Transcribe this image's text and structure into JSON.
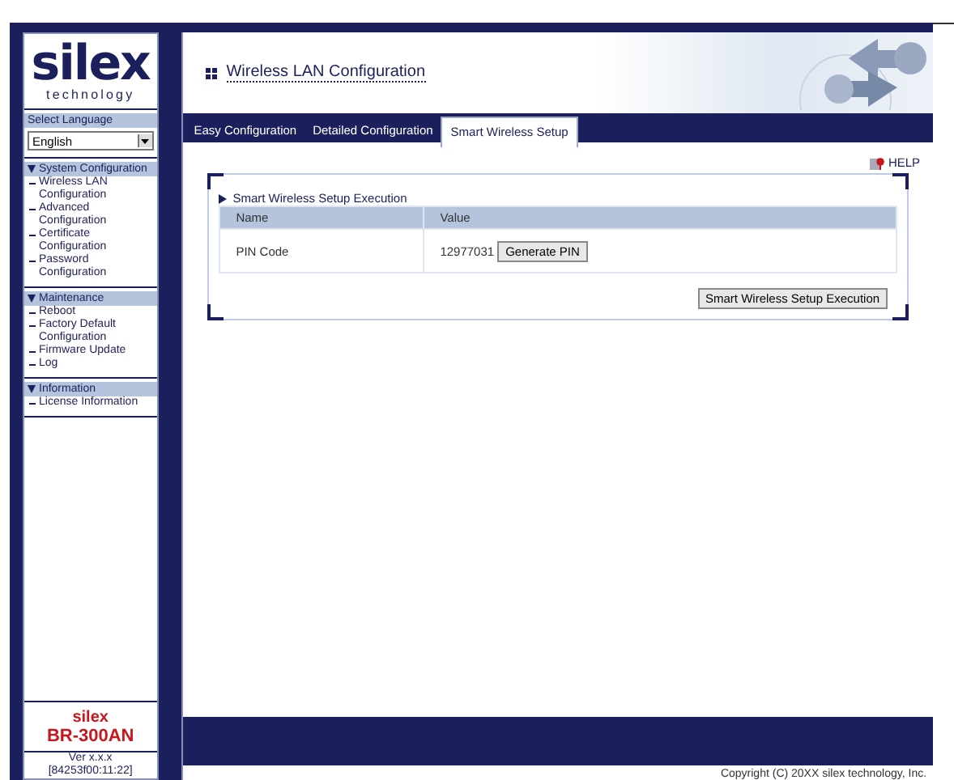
{
  "logo": {
    "name": "silex",
    "tagline": "technology"
  },
  "language": {
    "label": "Select Language",
    "value": "English"
  },
  "menu": [
    {
      "title": "System Configuration",
      "expanded": true,
      "items": [
        "Wireless LAN Configuration",
        "Advanced Configuration",
        "Certificate Configuration",
        "Password Configuration"
      ]
    },
    {
      "title": "Maintenance",
      "expanded": true,
      "items": [
        "Reboot",
        "Factory Default Configuration",
        "Firmware Update",
        "Log"
      ]
    },
    {
      "title": "Information",
      "expanded": true,
      "items": [
        "License Information"
      ]
    }
  ],
  "product": {
    "brand": "silex",
    "model": "BR-300AN",
    "version": "Ver x.x.x",
    "build": "[84253f00:11:22]"
  },
  "page_title": "Wireless LAN Configuration",
  "tabs": [
    {
      "label": "Easy Configuration",
      "selected": false
    },
    {
      "label": "Detailed Configuration",
      "selected": false
    },
    {
      "label": "Smart Wireless Setup",
      "selected": true
    }
  ],
  "help": "HELP",
  "section": {
    "title": "Smart Wireless Setup Execution",
    "columns": [
      "Name",
      "Value"
    ],
    "rows": [
      {
        "name": "PIN Code",
        "value": "12977031",
        "button": "Generate PIN"
      }
    ],
    "action": "Smart Wireless Setup Execution"
  },
  "copyright": "Copyright (C) 20XX silex technology, Inc."
}
